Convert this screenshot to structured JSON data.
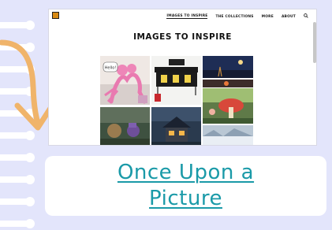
{
  "site": {
    "nav": [
      {
        "label": "IMAGES TO INSPIRE",
        "active": true
      },
      {
        "label": "THE COLLECTIONS",
        "active": false
      },
      {
        "label": "MORE",
        "active": false
      },
      {
        "label": "ABOUT",
        "active": false
      }
    ],
    "search_icon": "search-icon",
    "page_title": "IMAGES TO INSPIRE",
    "gallery": [
      {
        "name": "pink-creature-image",
        "speech": "Hello!"
      },
      {
        "name": "theatre-image",
        "speech": ""
      },
      {
        "name": "night-sky-image",
        "speech": ""
      },
      {
        "name": "orange-figure-image",
        "speech": ""
      },
      {
        "name": "mushroom-forest-image",
        "speech": ""
      },
      {
        "name": "forest-creatures-image",
        "speech": ""
      },
      {
        "name": "stormy-house-image",
        "speech": ""
      },
      {
        "name": "snowy-landscape-image",
        "speech": ""
      }
    ]
  },
  "card": {
    "title_line1": "Once Upon a",
    "title_line2": "Picture"
  },
  "colors": {
    "background": "#e3e5fb",
    "accent_orange": "#f0b46a",
    "title_teal": "#1a9aa8"
  }
}
